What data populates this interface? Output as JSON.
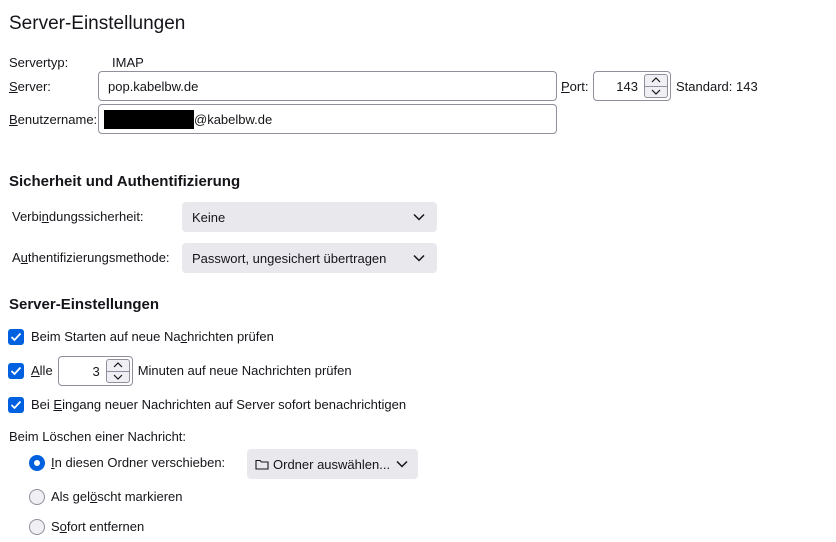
{
  "page_title": "Server-Einstellungen",
  "server_type": {
    "label": "Servertyp:",
    "value": "IMAP"
  },
  "server": {
    "label_pre": "",
    "label_u": "S",
    "label_post": "erver:",
    "value": "pop.kabelbw.de"
  },
  "port": {
    "label_u": "P",
    "label_post": "ort:",
    "value": "143",
    "default_text": "Standard: 143"
  },
  "username": {
    "label_u": "B",
    "label_post": "enutzername:",
    "value_suffix": "@kabelbw.de"
  },
  "security_section": {
    "heading": "Sicherheit und Authentifizierung",
    "connection_label_pre": "Verbi",
    "connection_label_u": "n",
    "connection_label_post": "dungssicherheit:",
    "connection_value": "Keine",
    "auth_label_pre": "A",
    "auth_label_u": "u",
    "auth_label_post": "thentifizierungsmethode:",
    "auth_value": "Passwort, ungesichert übertragen"
  },
  "server_settings_section": {
    "heading": "Server-Einstellungen",
    "check_on_start": {
      "pre": "Beim Starten auf neue Na",
      "u": "c",
      "post": "hrichten prüfen",
      "checked": true
    },
    "check_every": {
      "u": "A",
      "post": "lle",
      "minutes": "3",
      "suffix": "Minuten auf neue Nachrichten prüfen",
      "checked": true
    },
    "notify": {
      "pre": "Bei ",
      "u": "E",
      "post": "ingang neuer Nachrichten auf Server sofort benachrichtigen",
      "checked": true
    },
    "on_delete_label": "Beim Löschen einer Nachricht:",
    "move_to_folder": {
      "u": "I",
      "post": "n diesen Ordner verschieben:",
      "selected": true,
      "folder_button": "Ordner auswählen..."
    },
    "mark_deleted": {
      "pre": "Als gel",
      "u": "ö",
      "post": "scht markieren",
      "selected": false
    },
    "remove_now": {
      "pre": "S",
      "u": "o",
      "post": "fort entfernen",
      "selected": false
    }
  },
  "colors": {
    "accent": "#0061e0",
    "select_bg": "#e9e9ed",
    "border": "#8f8f9d",
    "redaction": "#000000"
  }
}
